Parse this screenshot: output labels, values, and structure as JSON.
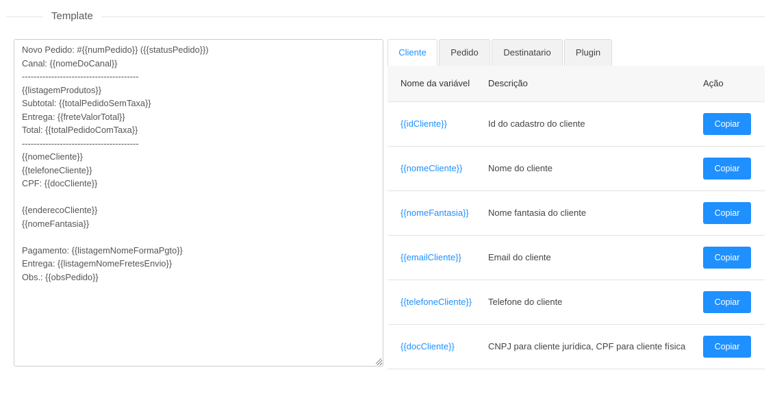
{
  "legend": {
    "title": "Template"
  },
  "template": {
    "value": "Novo Pedido: #{{numPedido}} ({{statusPedido}})\nCanal: {{nomeDoCanal}}\n----------------------------------------\n{{listagemProdutos}}\nSubtotal: {{totalPedidoSemTaxa}}\nEntrega: {{freteValorTotal}}\nTotal: {{totalPedidoComTaxa}}\n----------------------------------------\n{{nomeCliente}}\n{{telefoneCliente}}\nCPF: {{docCliente}}\n\n{{enderecoCliente}}\n{{nomeFantasia}}\n\nPagamento: {{listagemNomeFormaPgto}}\nEntrega: {{listagemNomeFretesEnvio}}\nObs.: {{obsPedido}}"
  },
  "tabs": [
    {
      "label": "Cliente",
      "active": true
    },
    {
      "label": "Pedido",
      "active": false
    },
    {
      "label": "Destinatario",
      "active": false
    },
    {
      "label": "Plugin",
      "active": false
    }
  ],
  "table": {
    "headers": {
      "variable": "Nome da variável",
      "description": "Descrição",
      "action": "Ação"
    },
    "rows": [
      {
        "variable": "{{idCliente}}",
        "description": "Id do cadastro do cliente",
        "button": "Copiar"
      },
      {
        "variable": "{{nomeCliente}}",
        "description": "Nome do cliente",
        "button": "Copiar"
      },
      {
        "variable": "{{nomeFantasia}}",
        "description": "Nome fantasia do cliente",
        "button": "Copiar"
      },
      {
        "variable": "{{emailCliente}}",
        "description": "Email do cliente",
        "button": "Copiar"
      },
      {
        "variable": "{{telefoneCliente}}",
        "description": "Telefone do cliente",
        "button": "Copiar"
      },
      {
        "variable": "{{docCliente}}",
        "description": "CNPJ para cliente jurídica, CPF para cliente física",
        "button": "Copiar"
      }
    ]
  },
  "colors": {
    "accent": "#1e90ff",
    "tab_inactive_bg": "#f2f2f2",
    "header_bg": "#f7f7f7",
    "border": "#e3e3e3"
  },
  "icons": {
    "resize_grip": "resize-grip-icon"
  }
}
